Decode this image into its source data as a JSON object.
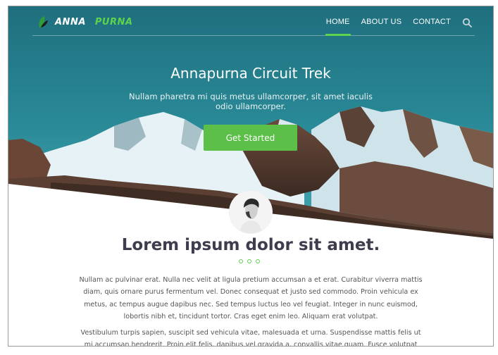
{
  "brand": {
    "name_part1": "ANNA",
    "name_part2": "PURNA",
    "accent": "#5dd44c"
  },
  "nav": {
    "items": [
      {
        "label": "HOME",
        "active": true
      },
      {
        "label": "ABOUT US",
        "active": false
      },
      {
        "label": "CONTACT",
        "active": false
      }
    ],
    "search_icon": "search-icon"
  },
  "hero": {
    "title": "Annapurna Circuit Trek",
    "subtitle": "Nullam pharetra mi quis metus ullamcorper, sit amet iaculis odio ullamcorper.",
    "cta_label": "Get Started",
    "cta_color": "#5cbf47"
  },
  "about": {
    "title": "Lorem ipsum dolor sit amet.",
    "paragraph1": "Nullam ac pulvinar erat. Nulla nec velit at ligula pretium accumsan a et erat. Curabitur viverra mattis diam, quis ornare purus fermentum vel. Donec consequat et justo sed commodo. Proin vehicula ex metus, ac tempus augue dapibus nec. Sed tempus luctus leo vel feugiat. Integer in nunc euismod, lobortis nibh et, tincidunt tortor. Cras eget enim leo. Aliquam erat volutpat.",
    "paragraph2": "Vestibulum turpis sapien, suscipit sed vehicula vitae, malesuada et urna. Suspendisse mattis felis ut mi accumsan hendrerit. Proin elit felis, dapibus vel gravida a, convallis vitae quam. Fusce volutpat sem nec"
  }
}
